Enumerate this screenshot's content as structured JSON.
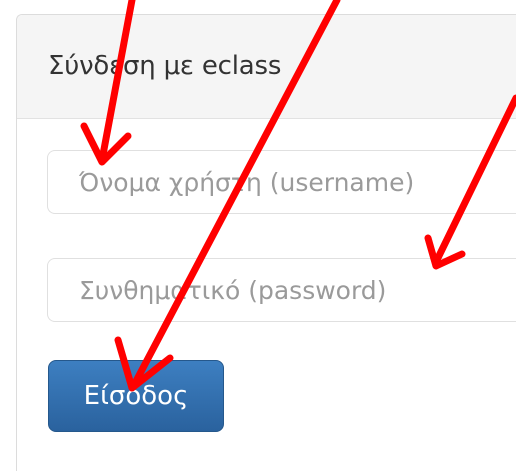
{
  "panel": {
    "title": "Σύνδεση με eclass"
  },
  "form": {
    "username_placeholder": "Όνομα χρήστη (username)",
    "username_value": "",
    "password_placeholder": "Συνθηματικό (password)",
    "password_value": "",
    "login_label": "Είσοδος"
  },
  "colors": {
    "button_blue": "#2f6ead",
    "annotation_arrows": "#ff0000"
  }
}
